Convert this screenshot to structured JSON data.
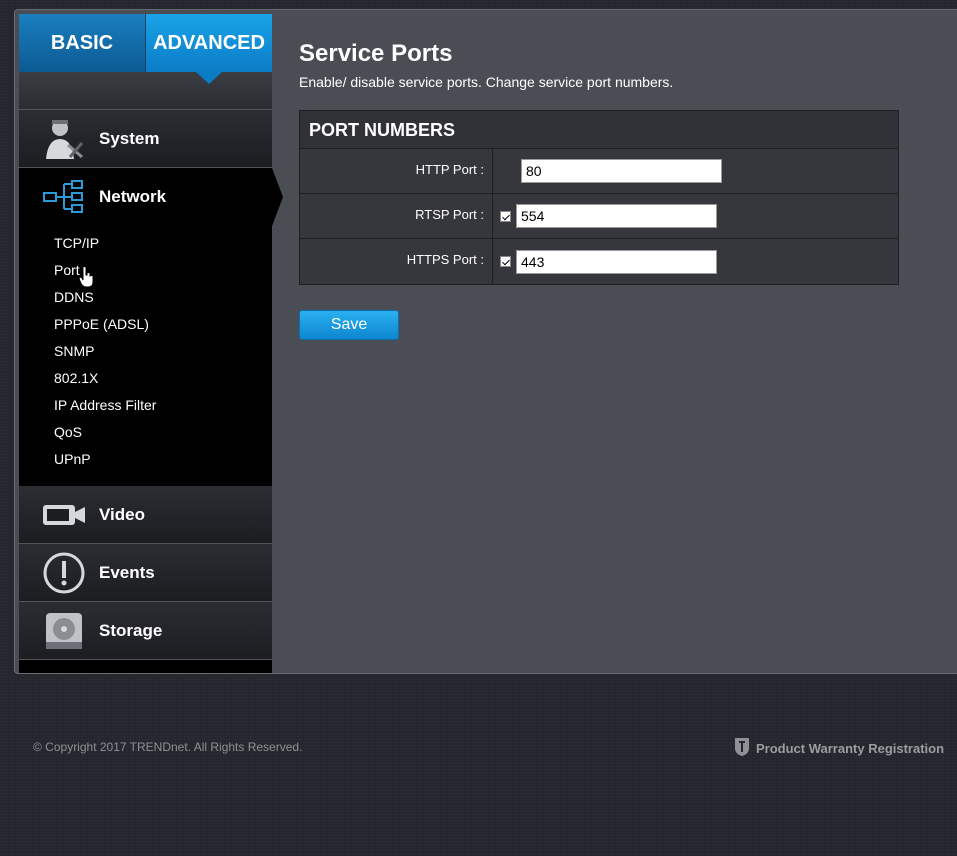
{
  "mode_tabs": {
    "basic": "BASIC",
    "advanced": "ADVANCED"
  },
  "sidebar": {
    "system": "System",
    "network": "Network",
    "network_sub": [
      "TCP/IP",
      "Port",
      "DDNS",
      "PPPoE (ADSL)",
      "SNMP",
      "802.1X",
      "IP Address Filter",
      "QoS",
      "UPnP"
    ],
    "video": "Video",
    "events": "Events",
    "storage": "Storage"
  },
  "main": {
    "title": "Service Ports",
    "description": "Enable/ disable service ports. Change service port numbers.",
    "table_header": "PORT NUMBERS",
    "rows": [
      {
        "label": "HTTP Port :",
        "value": "80",
        "has_checkbox": false
      },
      {
        "label": "RTSP Port :",
        "value": "554",
        "has_checkbox": true
      },
      {
        "label": "HTTPS Port :",
        "value": "443",
        "has_checkbox": true
      }
    ],
    "save_label": "Save"
  },
  "footer": {
    "copyright": "© Copyright 2017 TRENDnet. All Rights Reserved.",
    "warranty": "Product Warranty Registration"
  },
  "colors": {
    "accent": "#1aa3e8",
    "panel": "#4a4d54",
    "sidebar": "#000000"
  }
}
